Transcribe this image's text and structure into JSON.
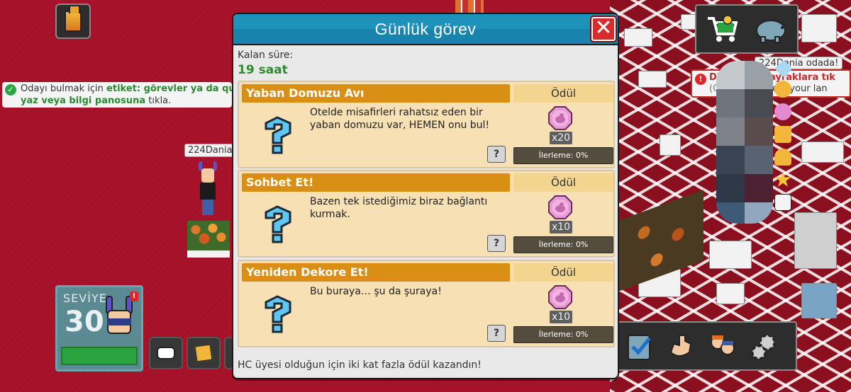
{
  "dialog": {
    "title": "Günlük görev",
    "remaining_label": "Kalan süre:",
    "remaining_value": "19 saat",
    "footer": "HC üyesi olduğun için iki kat fazla ödül kazandın!",
    "quests": [
      {
        "name": "Yaban Domuzu Avı",
        "reward_header": "Ödül",
        "description": "Otelde misafirleri rahatsız eden bir yaban domuzu var, HEMEN onu bul!",
        "reward_count": "x20",
        "progress": "İlerleme: 0%",
        "help": "?"
      },
      {
        "name": "Sohbet Et!",
        "reward_header": "Ödül",
        "description": "Bazen tek istediğimiz biraz bağlantı kurmak.",
        "reward_count": "x10",
        "progress": "İlerleme: 0%",
        "help": "?"
      },
      {
        "name": "Yeniden Dekore Et!",
        "reward_header": "Ödül",
        "description": "Bu buraya… şu da şuraya!",
        "reward_count": "x10",
        "progress": "İlerleme: 0%",
        "help": "?"
      }
    ]
  },
  "notice": {
    "line1_prefix": "Odayı bulmak için ",
    "line1_bold": "etiket: görevler ya da quest",
    "line2_bold": "yaz veya bilgi panosuna",
    "line2_suffix": " tıkla."
  },
  "avatar_name": "224Dania",
  "level": {
    "label": "SEVİYE",
    "value": "30",
    "alert": "!"
  },
  "room_tag": "224Dania odada!",
  "alert_banner": {
    "line1_a": "Dil",
    "line1_b": "bayraklara tık",
    "line2_a": "(Cli",
    "line2_b": "elect your lan"
  },
  "colors": {
    "header": "#1e8cb4",
    "quest_title": "#d98f14",
    "quest_bg": "#f6e0b4",
    "close": "#d82b2b",
    "time_green": "#2e8a2e",
    "background": "#a8132a"
  }
}
